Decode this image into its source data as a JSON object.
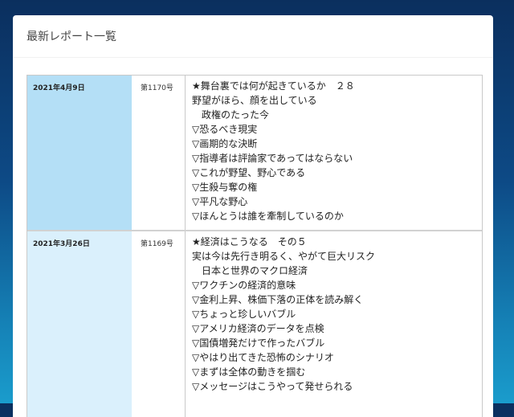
{
  "page": {
    "title": "最新レポート一覧"
  },
  "reports": [
    {
      "date": "2021年4月9日",
      "issue": "第1170号",
      "lines": [
        "★舞台裏では何が起きているか　２８",
        "野望がほら、顔を出している",
        "　政権のたった今",
        "▽恐るべき現実",
        "▽画期的な決断",
        "▽指導者は評論家であってはならない",
        "▽これが野望、野心である",
        "▽生殺与奪の権",
        "▽平凡な野心",
        "▽ほんとうは誰を牽制しているのか"
      ]
    },
    {
      "date": "2021年3月26日",
      "issue": "第1169号",
      "lines": [
        "★経済はこうなる　その５",
        "実は今は先行き明るく、やがて巨大リスク",
        "　日本と世界のマクロ経済",
        "▽ワクチンの経済的意味",
        "▽金利上昇、株価下落の正体を読み解く",
        "▽ちょっと珍しいバブル",
        "▽アメリカ経済のデータを点検",
        "▽国債増発だけで作ったバブル",
        "▽やはり出てきた恐怖のシナリオ",
        "▽まずは全体の動きを掴む",
        "▽メッセージはこうやって発せられる"
      ]
    }
  ]
}
